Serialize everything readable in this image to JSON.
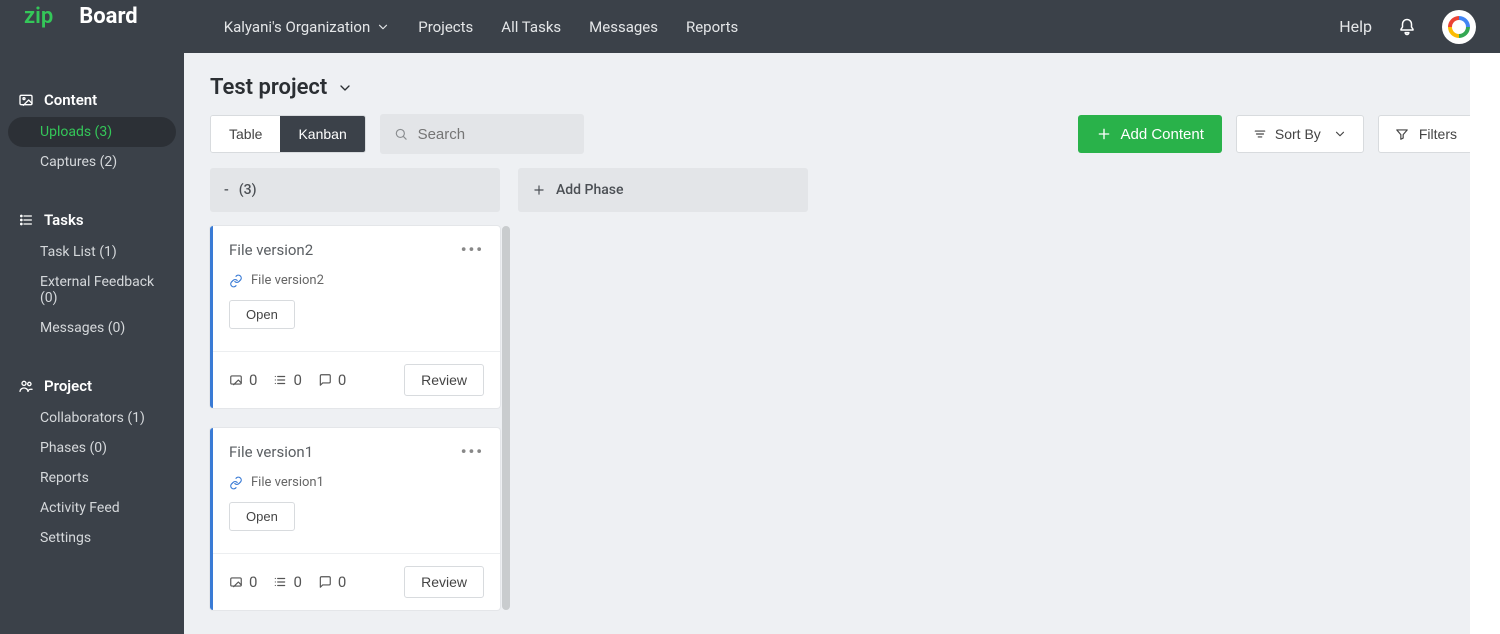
{
  "brand": {
    "zip": "zip",
    "board": "Board"
  },
  "nav": {
    "org": "Kalyani's Organization",
    "items": [
      "Projects",
      "All Tasks",
      "Messages",
      "Reports"
    ],
    "help": "Help"
  },
  "sidebar": {
    "content": {
      "heading": "Content",
      "uploads": "Uploads (3)",
      "captures": "Captures (2)"
    },
    "tasks": {
      "heading": "Tasks",
      "task_list": "Task List (1)",
      "external_feedback": "External Feedback (0)",
      "messages": "Messages (0)"
    },
    "project": {
      "heading": "Project",
      "collaborators": "Collaborators (1)",
      "phases": "Phases (0)",
      "reports": "Reports",
      "activity": "Activity Feed",
      "settings": "Settings"
    }
  },
  "page": {
    "title": "Test project"
  },
  "toolbar": {
    "table": "Table",
    "kanban": "Kanban",
    "search_placeholder": "Search",
    "add_content": "Add Content",
    "sort": "Sort By",
    "filters": "Filters"
  },
  "board": {
    "column": {
      "label": "- ",
      "count": "(3)"
    },
    "add_phase": "Add Phase",
    "cards": [
      {
        "title": "File version2",
        "link": "File version2",
        "open": "Open",
        "img_count": "0",
        "task_count": "0",
        "comment_count": "0",
        "review": "Review"
      },
      {
        "title": "File version1",
        "link": "File version1",
        "open": "Open",
        "img_count": "0",
        "task_count": "0",
        "comment_count": "0",
        "review": "Review"
      }
    ]
  }
}
